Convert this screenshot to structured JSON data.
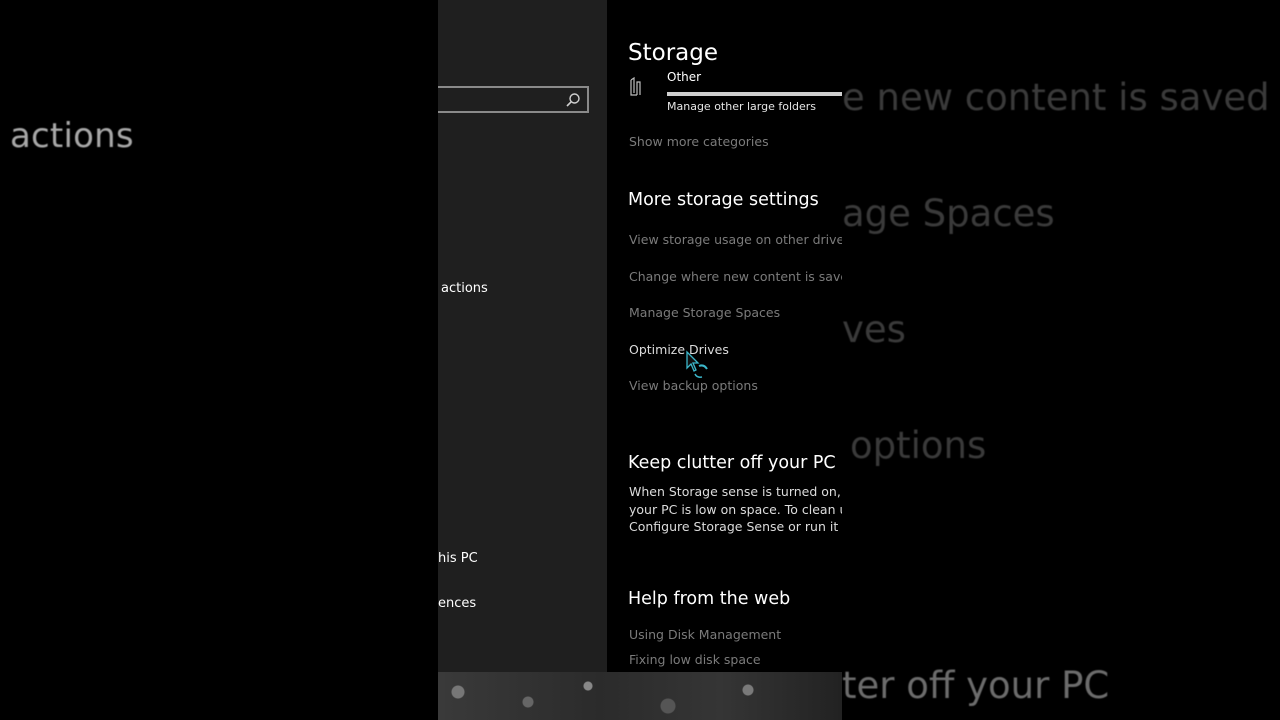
{
  "left_overlay": {
    "ghost_text": "actions"
  },
  "sidebar": {
    "partial_items": [
      "actions",
      "his PC",
      "ences"
    ]
  },
  "main": {
    "title": "Storage",
    "other_category": {
      "label": "Other",
      "description": "Manage other large folders",
      "usage_fraction": 1.0
    },
    "show_more_link": "Show more categories",
    "more_settings": {
      "title": "More storage settings",
      "links": [
        "View storage usage on other drives",
        "Change where new content is saved",
        "Manage Storage Spaces",
        "Optimize Drives",
        "View backup options"
      ],
      "hovered_index": 3
    },
    "clutter": {
      "title": "Keep clutter off your PC",
      "lines": [
        "When Storage sense is turned on, it'll",
        "your PC is low on space. To clean up",
        "Configure Storage Sense or run it no"
      ]
    },
    "help": {
      "title": "Help from the web",
      "links": [
        "Using Disk Management",
        "Fixing low disk space"
      ]
    }
  },
  "right_overlay": {
    "ghost_lines": [
      "e new content is saved",
      "age Spaces",
      "ves",
      "options",
      "ter off your PC"
    ]
  }
}
